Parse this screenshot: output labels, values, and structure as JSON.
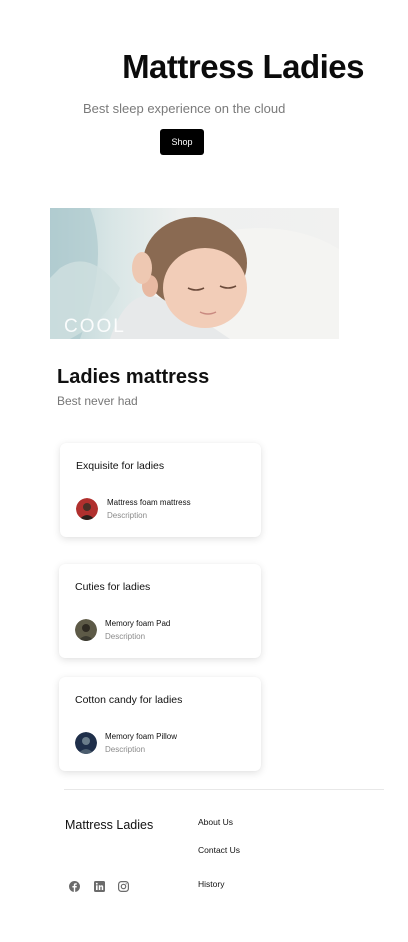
{
  "hero": {
    "title": "Mattress Ladies",
    "subtitle": "Best sleep experience on the cloud",
    "shop_label": "Shop"
  },
  "banner": {
    "overlay_text": "COOL"
  },
  "section": {
    "title": "Ladies mattress",
    "subtitle": "Best never had"
  },
  "cards": [
    {
      "title": "Exquisite for ladies",
      "item_name": "Mattress foam mattress",
      "item_desc": "Description"
    },
    {
      "title": "Cuties for ladies",
      "item_name": "Memory foam Pad",
      "item_desc": "Description"
    },
    {
      "title": "Cotton candy for ladies",
      "item_name": "Memory foam Pillow",
      "item_desc": "Description"
    }
  ],
  "footer": {
    "brand": "Mattress Ladies",
    "links": [
      "About Us",
      "Contact Us",
      "History"
    ],
    "social_icons": [
      "facebook-icon",
      "linkedin-icon",
      "instagram-icon"
    ]
  },
  "colors": {
    "accent": "#000000",
    "muted_text": "#7a7a7a"
  }
}
